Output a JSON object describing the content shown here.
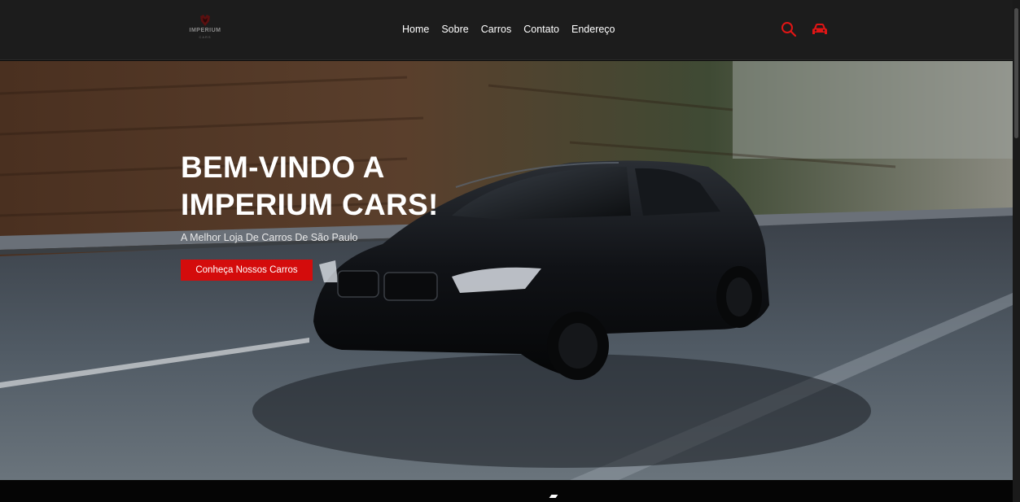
{
  "header": {
    "logo_text": "IMPERIUM",
    "logo_sub": "CARS",
    "nav": [
      {
        "label": "Home"
      },
      {
        "label": "Sobre"
      },
      {
        "label": "Carros"
      },
      {
        "label": "Contato"
      },
      {
        "label": "Endereço"
      }
    ],
    "icons": [
      "search-icon",
      "car-icon"
    ],
    "accent_color": "#d40c0c"
  },
  "hero": {
    "title_line1": "BEM-VINDO A",
    "title_line2": "IMPERIUM CARS!",
    "subtitle": "A Melhor Loja De Carros De São Paulo",
    "cta_label": "Conheça Nossos Carros",
    "cta_color": "#d40c0c"
  }
}
